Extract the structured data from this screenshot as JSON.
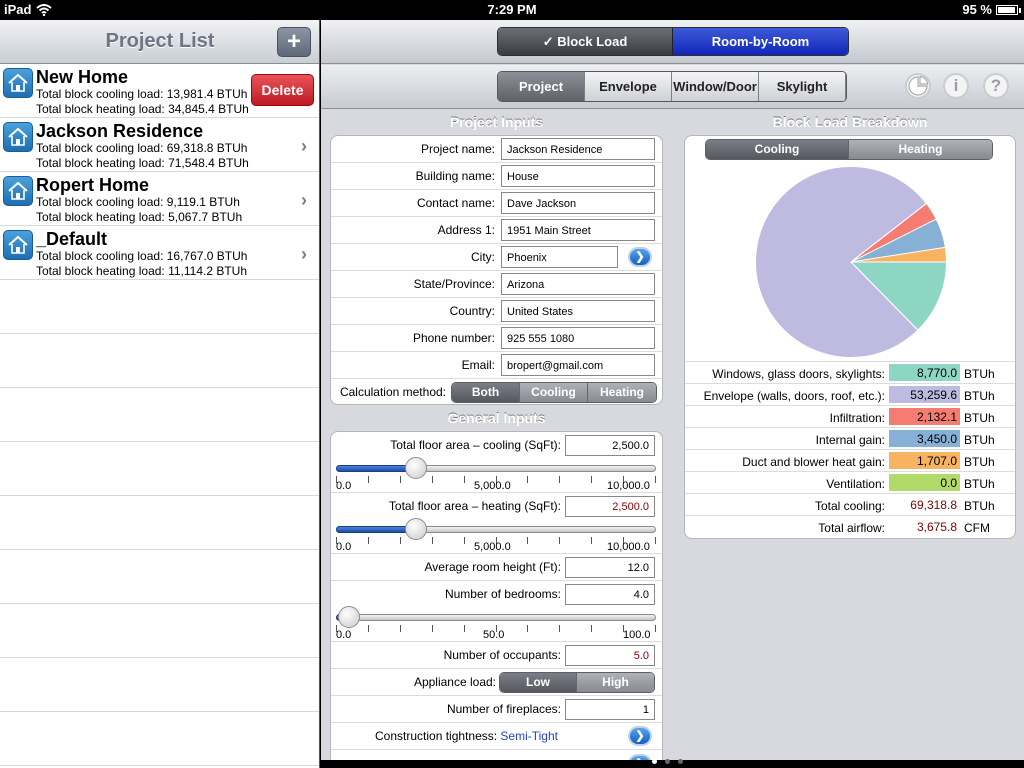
{
  "status": {
    "device": "iPad",
    "time": "7:29 PM",
    "battery": "95 %",
    "battery_level": 0.95
  },
  "left_panel": {
    "title": "Project List",
    "add_label": "+",
    "delete_label": "Delete",
    "projects": [
      {
        "name": "New Home",
        "cooling": "Total block cooling load: 13,981.4 BTUh",
        "heating": "Total block heating load: 34,845.4 BTUh"
      },
      {
        "name": "Jackson Residence",
        "cooling": "Total block cooling load: 69,318.8 BTUh",
        "heating": "Total block heating load: 71,548.4 BTUh"
      },
      {
        "name": "Ropert Home",
        "cooling": "Total block cooling load: 9,119.1 BTUh",
        "heating": "Total block heating load: 5,067.7 BTUh"
      },
      {
        "name": "_Default",
        "cooling": "Total block cooling load: 16,767.0 BTUh",
        "heating": "Total block heating load: 11,114.2 BTUh"
      }
    ]
  },
  "mode_tabs": [
    "✓ Block Load",
    "Room-by-Room"
  ],
  "sub_tabs": [
    "Project",
    "Envelope",
    "Window/Door",
    "Skylight"
  ],
  "icons": {
    "pie": "pie-chart-icon",
    "info": "i",
    "help": "?"
  },
  "project_inputs": {
    "title": "Project Inputs",
    "fields": [
      {
        "label": "Project name:",
        "value": "Jackson Residence"
      },
      {
        "label": "Building name:",
        "value": "House"
      },
      {
        "label": "Contact name:",
        "value": "Dave Jackson"
      },
      {
        "label": "Address 1:",
        "value": "1951 Main Street"
      },
      {
        "label": "City:",
        "value": "Phoenix"
      },
      {
        "label": "State/Province:",
        "value": "Arizona"
      },
      {
        "label": "Country:",
        "value": "United States"
      },
      {
        "label": "Phone number:",
        "value": "925 555 1080"
      },
      {
        "label": "Email:",
        "value": "bropert@gmail.com"
      }
    ],
    "calc_label": "Calculation method:",
    "calc_options": [
      "Both",
      "Cooling",
      "Heating"
    ],
    "calc_selected": "Both"
  },
  "general_inputs": {
    "title": "General Inputs",
    "floor_cooling": {
      "label": "Total floor area – cooling (SqFt):",
      "value": "2,500.0",
      "slider_value": 2500,
      "slider_min": 0,
      "slider_max": 10000,
      "ticks": [
        "0.0",
        "5,000.0",
        "10,000.0"
      ]
    },
    "floor_heating": {
      "label": "Total floor area – heating (SqFt):",
      "value": "2,500.0",
      "slider_value": 2500,
      "slider_min": 0,
      "slider_max": 10000,
      "ticks": [
        "0.0",
        "5,000.0",
        "10,000.0"
      ]
    },
    "room_height": {
      "label": "Average room height (Ft):",
      "value": "12.0"
    },
    "bedrooms": {
      "label": "Number of bedrooms:",
      "value": "4.0",
      "slider_value": 4,
      "slider_min": 0,
      "slider_max": 100,
      "ticks": [
        "0.0",
        "50.0",
        "100.0"
      ]
    },
    "occupants": {
      "label": "Number of occupants:",
      "value": "5.0"
    },
    "appliance": {
      "label": "Appliance load:",
      "options": [
        "Low",
        "High"
      ],
      "selected": "Low"
    },
    "fireplaces": {
      "label": "Number of fireplaces:",
      "value": "1"
    },
    "tightness": {
      "label": "Construction tightness:",
      "value": "Semi-Tight"
    }
  },
  "breakdown": {
    "title": "Block Load Breakdown",
    "tabs": [
      "Cooling",
      "Heating"
    ],
    "selected_tab": "Cooling",
    "rows": [
      {
        "label": "Windows, glass doors, skylights:",
        "value": "8,770.0",
        "unit": "BTUh",
        "color": "#8ed6c4"
      },
      {
        "label": "Envelope (walls, doors, roof, etc.):",
        "value": "53,259.6",
        "unit": "BTUh",
        "color": "#bebae0"
      },
      {
        "label": "Infiltration:",
        "value": "2,132.1",
        "unit": "BTUh",
        "color": "#f47c70"
      },
      {
        "label": "Internal gain:",
        "value": "3,450.0",
        "unit": "BTUh",
        "color": "#86b0d6"
      },
      {
        "label": "Duct and blower heat gain:",
        "value": "1,707.0",
        "unit": "BTUh",
        "color": "#f8b360"
      },
      {
        "label": "Ventilation:",
        "value": "0.0",
        "unit": "BTUh",
        "color": "#b2da6a"
      }
    ],
    "total_cooling": {
      "label": "Total cooling:",
      "value": "69,318.8",
      "unit": "BTUh"
    },
    "total_airflow": {
      "label": "Total airflow:",
      "value": "3,675.8",
      "unit": "CFM"
    }
  },
  "chart_data": {
    "type": "pie",
    "categories": [
      "Windows, glass doors, skylights",
      "Envelope (walls, doors, roof, etc.)",
      "Infiltration",
      "Internal gain",
      "Duct and blower heat gain",
      "Ventilation"
    ],
    "values": [
      8770.0,
      53259.6,
      2132.1,
      3450.0,
      1707.0,
      0.0
    ],
    "colors": [
      "#8ed6c4",
      "#bebae0",
      "#f47c70",
      "#86b0d6",
      "#f8b360",
      "#b2da6a"
    ]
  },
  "page_dots": {
    "count": 3,
    "active": 0
  }
}
